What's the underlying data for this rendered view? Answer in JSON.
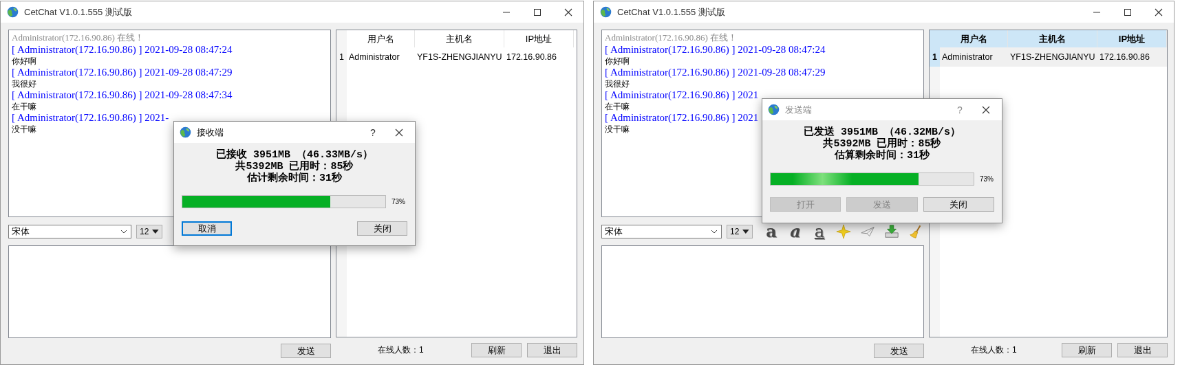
{
  "windows": [
    {
      "title": "CetChat V1.0.1.555 测试版",
      "chat": [
        {
          "kind": "status",
          "text": "Administrator(172.16.90.86) 在线！"
        },
        {
          "kind": "header",
          "text": "[ Administrator(172.16.90.86) ] 2021-09-28 08:47:24"
        },
        {
          "kind": "message",
          "text": "你好啊"
        },
        {
          "kind": "header",
          "text": "[ Administrator(172.16.90.86) ] 2021-09-28 08:47:29"
        },
        {
          "kind": "message",
          "text": "我很好"
        },
        {
          "kind": "header",
          "text": "[ Administrator(172.16.90.86) ] 2021-09-28 08:47:34"
        },
        {
          "kind": "message",
          "text": "在干嘛"
        },
        {
          "kind": "header",
          "text": "[ Administrator(172.16.90.86) ] 2021-"
        },
        {
          "kind": "message",
          "text": "没干嘛"
        }
      ],
      "font": "宋体",
      "font_size": "12",
      "send_button": "发送",
      "users": {
        "focused": false,
        "columns": [
          "用户名",
          "主机名",
          "IP地址"
        ],
        "rows": [
          {
            "index": "1",
            "cells": [
              "Administrator",
              "YF1S-ZHENGJIANYU",
              "172.16.90.86"
            ],
            "selected": false
          }
        ]
      },
      "online_count": "在线人数：1",
      "buttons": [
        "刷新",
        "退出"
      ],
      "dialog": {
        "title": "接收端",
        "active": true,
        "help": "?",
        "lines": [
          "已接收 3951MB （46.33MB/s）",
          "共5392MB 已用时：85秒",
          "估计剩余时间：31秒"
        ],
        "progress": {
          "level": 0.73,
          "reading": "73%",
          "shine": false
        },
        "buttons": [
          {
            "label": "取消",
            "focused": true,
            "disabled": false
          },
          {
            "label": "关闭",
            "focused": false,
            "disabled": false
          }
        ]
      }
    },
    {
      "title": "CetChat V1.0.1.555 测试版",
      "chat": [
        {
          "kind": "status",
          "text": "Administrator(172.16.90.86) 在线！"
        },
        {
          "kind": "header",
          "text": "[ Administrator(172.16.90.86) ] 2021-09-28 08:47:24"
        },
        {
          "kind": "message",
          "text": "你好啊"
        },
        {
          "kind": "header",
          "text": "[ Administrator(172.16.90.86) ] 2021-09-28 08:47:29"
        },
        {
          "kind": "message",
          "text": "我很好"
        },
        {
          "kind": "header",
          "text": "[ Administrator(172.16.90.86) ] 2021"
        },
        {
          "kind": "message",
          "text": "在干嘛"
        },
        {
          "kind": "header",
          "text": "[ Administrator(172.16.90.86) ] 2021"
        },
        {
          "kind": "message",
          "text": "没干嘛"
        }
      ],
      "font": "宋体",
      "font_size": "12",
      "format_tools": [
        {
          "kind": "bold",
          "glyph": "a"
        },
        {
          "kind": "italic",
          "glyph": "a"
        },
        {
          "kind": "underline",
          "glyph": "a"
        },
        {
          "kind": "star"
        },
        {
          "kind": "plane"
        },
        {
          "kind": "save"
        },
        {
          "kind": "broom"
        }
      ],
      "send_button": "发送",
      "users": {
        "focused": true,
        "columns": [
          "用户名",
          "主机名",
          "IP地址"
        ],
        "rows": [
          {
            "index": "1",
            "cells": [
              "Administrator",
              "YF1S-ZHENGJIANYU",
              "172.16.90.86"
            ],
            "selected": true
          }
        ]
      },
      "online_count": "在线人数：1",
      "buttons": [
        "刷新",
        "退出"
      ],
      "dialog": {
        "title": "发送端",
        "active": false,
        "help": "?",
        "lines": [
          "已发送 3951MB （46.32MB/s）",
          "共5392MB 已用时：85秒",
          "估算剩余时间：31秒"
        ],
        "progress": {
          "level": 0.73,
          "reading": "73%",
          "shine": true
        },
        "buttons": [
          {
            "label": "打开",
            "focused": false,
            "disabled": true
          },
          {
            "label": "发送",
            "focused": false,
            "disabled": true
          },
          {
            "label": "关闭",
            "focused": false,
            "disabled": false
          }
        ]
      }
    }
  ]
}
